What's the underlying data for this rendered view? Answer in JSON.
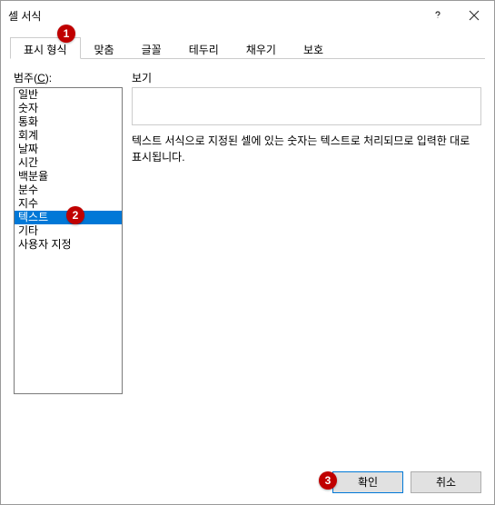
{
  "window": {
    "title": "셀 서식"
  },
  "tabs": {
    "items": [
      {
        "label": "표시 형식",
        "active": true
      },
      {
        "label": "맞춤",
        "active": false
      },
      {
        "label": "글꼴",
        "active": false
      },
      {
        "label": "테두리",
        "active": false
      },
      {
        "label": "채우기",
        "active": false
      },
      {
        "label": "보호",
        "active": false
      }
    ]
  },
  "category": {
    "label_prefix": "범주(",
    "label_key": "C",
    "label_suffix": "):",
    "items": [
      {
        "label": "일반",
        "selected": false
      },
      {
        "label": "숫자",
        "selected": false
      },
      {
        "label": "통화",
        "selected": false
      },
      {
        "label": "회계",
        "selected": false
      },
      {
        "label": "날짜",
        "selected": false
      },
      {
        "label": "시간",
        "selected": false
      },
      {
        "label": "백분율",
        "selected": false
      },
      {
        "label": "분수",
        "selected": false
      },
      {
        "label": "지수",
        "selected": false
      },
      {
        "label": "텍스트",
        "selected": true
      },
      {
        "label": "기타",
        "selected": false
      },
      {
        "label": "사용자 지정",
        "selected": false
      }
    ]
  },
  "preview": {
    "label": "보기"
  },
  "description": {
    "text": "텍스트 서식으로 지정된 셀에 있는 숫자는 텍스트로 처리되므로 입력한 대로 표시됩니다."
  },
  "footer": {
    "ok_label": "확인",
    "cancel_label": "취소"
  },
  "badges": {
    "b1": "1",
    "b2": "2",
    "b3": "3"
  }
}
